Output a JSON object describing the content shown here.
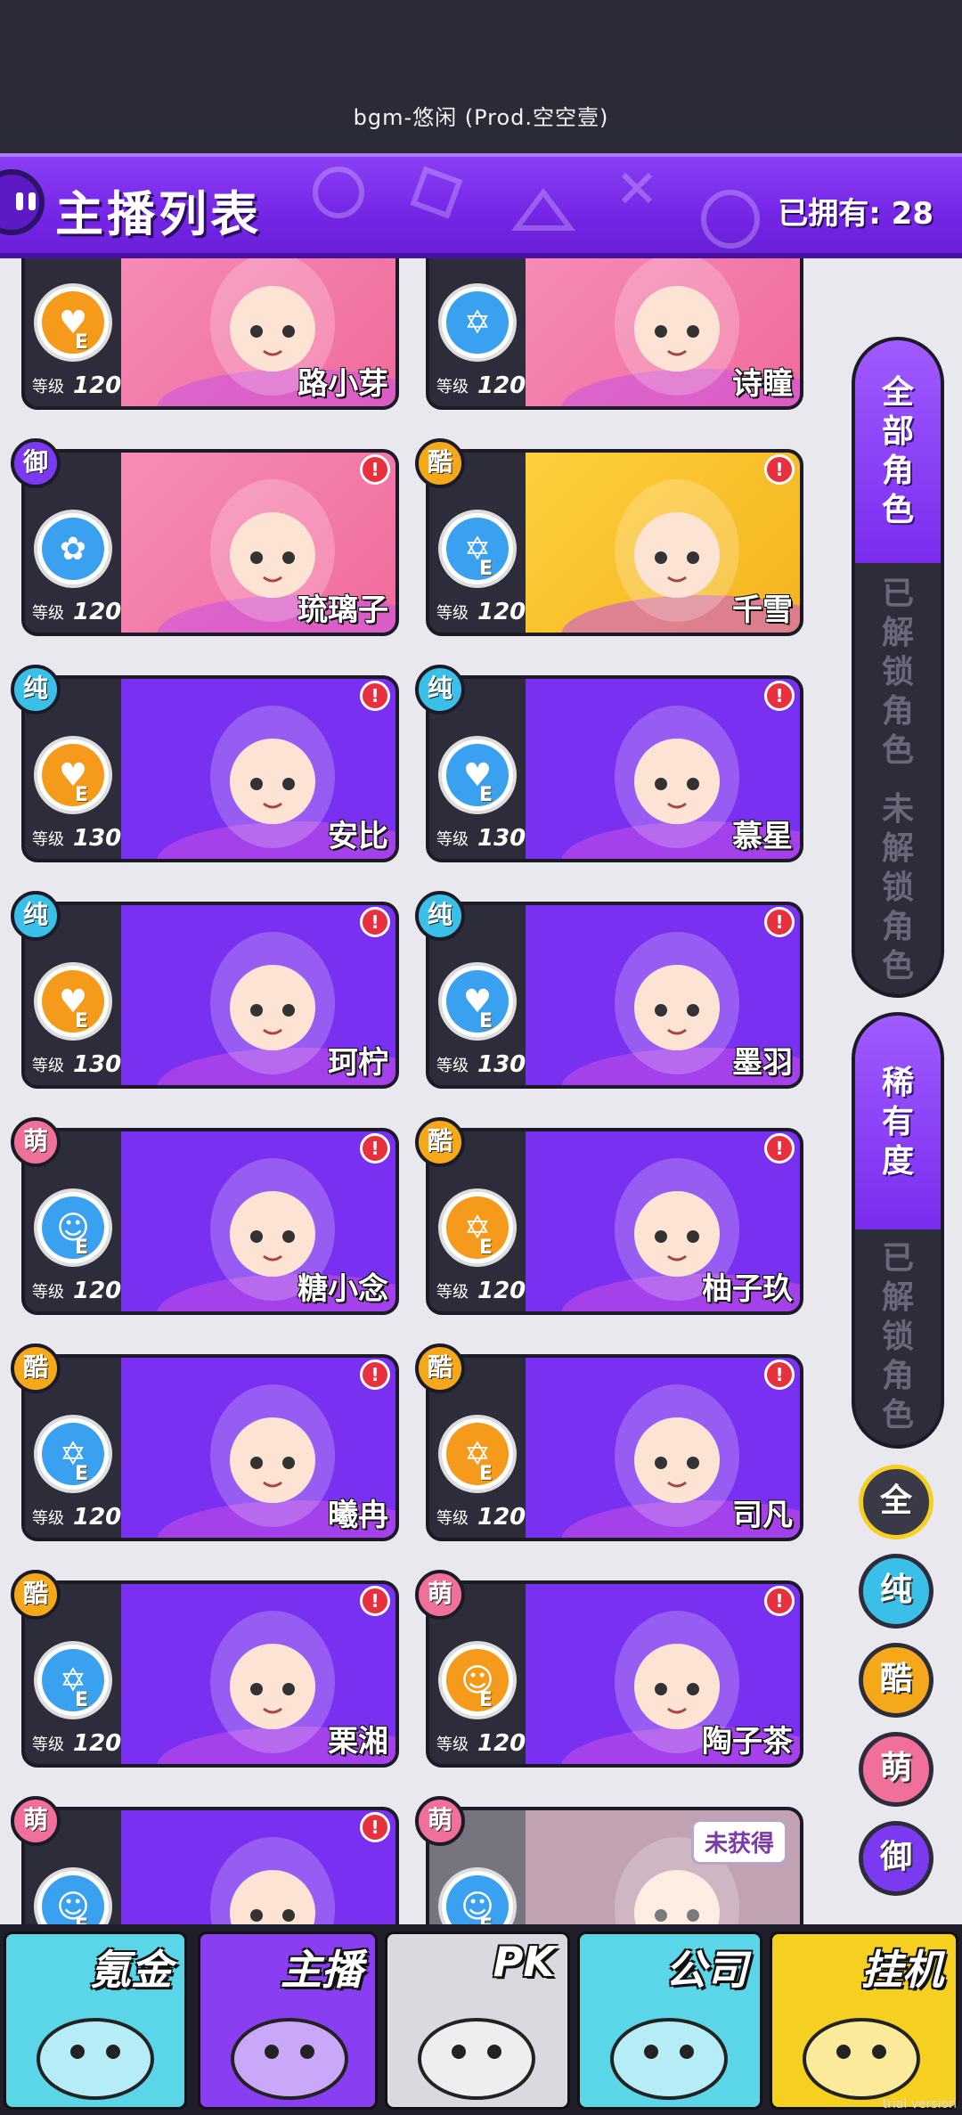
{
  "top_bar": {
    "bgm": "bgm-悠闲 (Prod.空空壹)"
  },
  "header": {
    "title": "主播列表",
    "owned_label": "已拥有: 28"
  },
  "level_label": "等级",
  "cards": [
    {
      "name": "路小芽",
      "level": "120",
      "rarity": "",
      "rarity_color": "",
      "stat": "heart",
      "stat_color": "#f59a1a",
      "tier": "E",
      "art": "pink",
      "alert": false
    },
    {
      "name": "诗瞳",
      "level": "120",
      "rarity": "",
      "rarity_color": "",
      "stat": "star",
      "stat_color": "#3aa0f0",
      "tier": "",
      "art": "pink",
      "alert": false
    },
    {
      "name": "琉璃子",
      "level": "120",
      "rarity": "御",
      "rarity_color": "#7b3af0",
      "stat": "rose",
      "stat_color": "#3aa0f0",
      "tier": "",
      "art": "pink",
      "alert": true
    },
    {
      "name": "千雪",
      "level": "120",
      "rarity": "酷",
      "rarity_color": "#f5a91a",
      "stat": "star",
      "stat_color": "#3aa0f0",
      "tier": "E",
      "art": "yellow",
      "alert": true
    },
    {
      "name": "安比",
      "level": "130",
      "rarity": "纯",
      "rarity_color": "#3ac0e8",
      "stat": "pulse",
      "stat_color": "#f59a1a",
      "tier": "E",
      "art": "purple",
      "alert": true
    },
    {
      "name": "慕星",
      "level": "130",
      "rarity": "纯",
      "rarity_color": "#3ac0e8",
      "stat": "pulse",
      "stat_color": "#3aa0f0",
      "tier": "E",
      "art": "purple",
      "alert": true
    },
    {
      "name": "珂柠",
      "level": "130",
      "rarity": "纯",
      "rarity_color": "#3ac0e8",
      "stat": "pulse",
      "stat_color": "#f59a1a",
      "tier": "E",
      "art": "purple",
      "alert": true
    },
    {
      "name": "墨羽",
      "level": "130",
      "rarity": "纯",
      "rarity_color": "#3ac0e8",
      "stat": "pulse",
      "stat_color": "#3aa0f0",
      "tier": "E",
      "art": "purple",
      "alert": true
    },
    {
      "name": "糖小念",
      "level": "120",
      "rarity": "萌",
      "rarity_color": "#f0709a",
      "stat": "cat",
      "stat_color": "#3aa0f0",
      "tier": "E",
      "art": "purple",
      "alert": true
    },
    {
      "name": "柚子玖",
      "level": "120",
      "rarity": "酷",
      "rarity_color": "#f5a91a",
      "stat": "star",
      "stat_color": "#f59a1a",
      "tier": "E",
      "art": "purple",
      "alert": true
    },
    {
      "name": "曦冉",
      "level": "120",
      "rarity": "酷",
      "rarity_color": "#f5a91a",
      "stat": "star",
      "stat_color": "#3aa0f0",
      "tier": "E",
      "art": "purple",
      "alert": true
    },
    {
      "name": "司凡",
      "level": "120",
      "rarity": "酷",
      "rarity_color": "#f5a91a",
      "stat": "star",
      "stat_color": "#f59a1a",
      "tier": "E",
      "art": "purple",
      "alert": true
    },
    {
      "name": "栗湘",
      "level": "120",
      "rarity": "酷",
      "rarity_color": "#f5a91a",
      "stat": "star",
      "stat_color": "#3aa0f0",
      "tier": "E",
      "art": "purple",
      "alert": true
    },
    {
      "name": "陶子茶",
      "level": "120",
      "rarity": "萌",
      "rarity_color": "#f0709a",
      "stat": "cat",
      "stat_color": "#f59a1a",
      "tier": "E",
      "art": "purple",
      "alert": true
    },
    {
      "name": "",
      "level": "",
      "rarity": "萌",
      "rarity_color": "#f0709a",
      "stat": "cat",
      "stat_color": "#3aa0f0",
      "tier": "E",
      "art": "purple",
      "alert": true
    },
    {
      "name": "",
      "level": "",
      "rarity": "萌",
      "rarity_color": "#f0709a",
      "stat": "cat",
      "stat_color": "#3aa0f0",
      "tier": "E",
      "art": "dim",
      "alert": false,
      "locked": "未获得"
    }
  ],
  "side_panel_1": {
    "tabs": [
      "全部角色",
      "已解锁角色",
      "未解锁角色"
    ],
    "active": 0
  },
  "side_panel_2": {
    "tabs": [
      "稀有度",
      "已解锁角色"
    ],
    "active": 0
  },
  "filters": [
    {
      "label": "全",
      "color": "#3a3948",
      "ring": "#f5d020"
    },
    {
      "label": "纯",
      "color": "#3ac0e8",
      "ring": "#2d2c3b"
    },
    {
      "label": "酷",
      "color": "#f5a91a",
      "ring": "#2d2c3b"
    },
    {
      "label": "萌",
      "color": "#f0709a",
      "ring": "#2d2c3b"
    },
    {
      "label": "御",
      "color": "#7b3af0",
      "ring": "#2d2c3b"
    }
  ],
  "bottom_nav": [
    {
      "label": "氪金",
      "bg": "#5bd6e8"
    },
    {
      "label": "主播",
      "bg": "#8a3ef2"
    },
    {
      "label": "PK",
      "bg": "#d9d9e0"
    },
    {
      "label": "公司",
      "bg": "#5bd6e8"
    },
    {
      "label": "挂机",
      "bg": "#f5d020"
    }
  ],
  "watermark": "trial version"
}
